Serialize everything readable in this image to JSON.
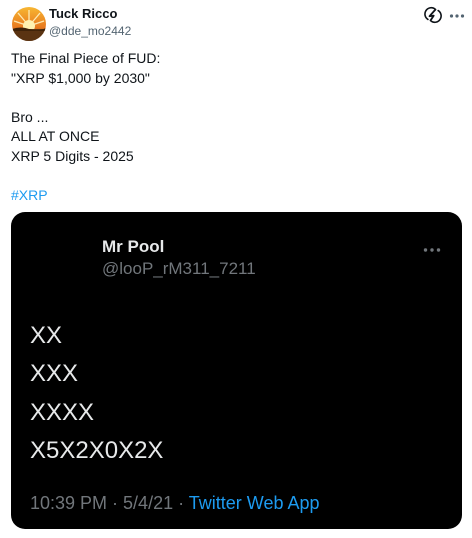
{
  "author": {
    "name": "Tuck Ricco",
    "handle": "@dde_mo2442"
  },
  "tweet": {
    "lines": [
      "The Final Piece of FUD:",
      "\"XRP $1,000 by 2030\"",
      "",
      "Bro ...",
      "ALL AT ONCE",
      "XRP 5 Digits - 2025",
      ""
    ],
    "hashtag": "#XRP"
  },
  "quoted": {
    "name": "Mr Pool",
    "handle": "@looP_rM311_7211",
    "lines": [
      "XX",
      "XXX",
      "XXXX",
      "X5X2X0X2X"
    ],
    "time": "10:39 PM",
    "separator1": " · ",
    "date": "5/4/21",
    "separator2": " · ",
    "app": "Twitter Web App"
  },
  "icons": {
    "avatar": "sunset-avatar",
    "grok": "grok-icon",
    "more": "more-icon"
  },
  "colors": {
    "link": "#1d9bf0",
    "secondary_text": "#536471",
    "card_background": "#000000",
    "card_text": "#e7e9ea",
    "card_secondary": "#71767b"
  }
}
